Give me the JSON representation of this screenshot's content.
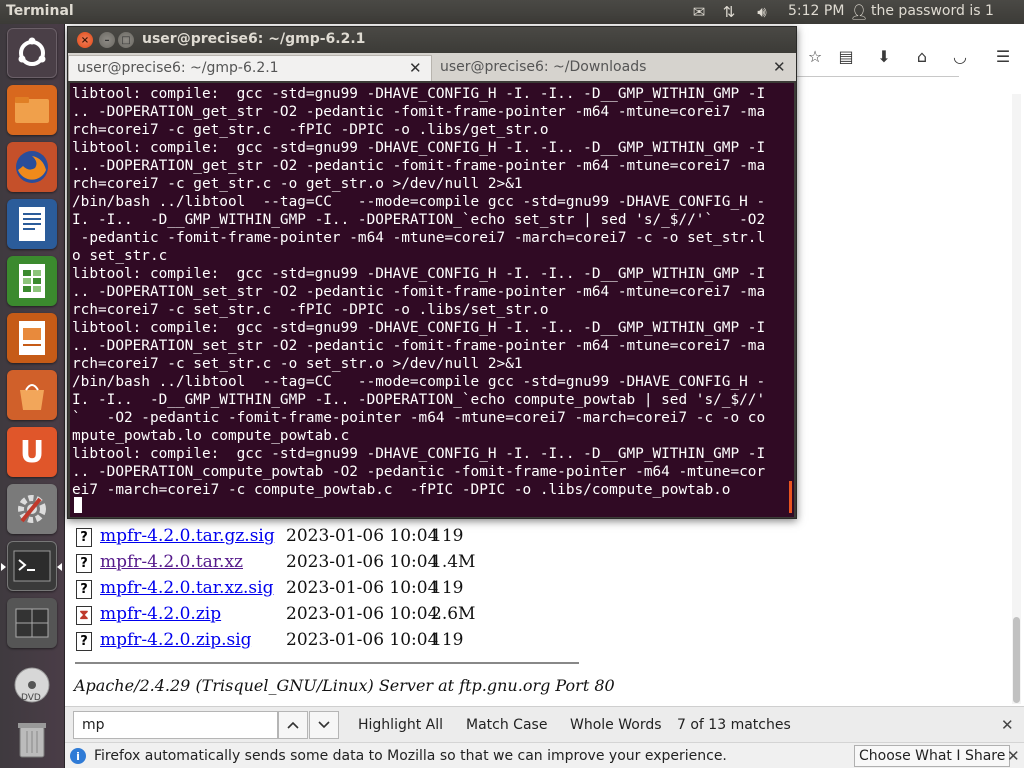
{
  "top_panel": {
    "app_title": "Terminal",
    "clock": "5:12 PM",
    "user_status": "the password is 1",
    "icons": [
      "mail-icon",
      "network-icon",
      "volume-icon",
      "user-icon"
    ]
  },
  "launcher": {
    "items": [
      "dash-icon",
      "files-icon",
      "firefox-icon",
      "writer-icon",
      "calc-icon",
      "impress-icon",
      "software-center-icon",
      "ubuntu-one-icon",
      "system-settings-icon",
      "terminal-icon",
      "workspace-switcher-icon",
      "dvd-icon",
      "trash-icon"
    ]
  },
  "terminal": {
    "window_title": "user@precise6: ~/gmp-6.2.1",
    "tabs": [
      {
        "label": "user@precise6: ~/gmp-6.2.1"
      },
      {
        "label": "user@precise6: ~/Downloads"
      }
    ],
    "lines": [
      "libtool: compile:  gcc -std=gnu99 -DHAVE_CONFIG_H -I. -I.. -D__GMP_WITHIN_GMP -I",
      ".. -DOPERATION_get_str -O2 -pedantic -fomit-frame-pointer -m64 -mtune=corei7 -ma",
      "rch=corei7 -c get_str.c  -fPIC -DPIC -o .libs/get_str.o",
      "libtool: compile:  gcc -std=gnu99 -DHAVE_CONFIG_H -I. -I.. -D__GMP_WITHIN_GMP -I",
      ".. -DOPERATION_get_str -O2 -pedantic -fomit-frame-pointer -m64 -mtune=corei7 -ma",
      "rch=corei7 -c get_str.c -o get_str.o >/dev/null 2>&1",
      "/bin/bash ../libtool  --tag=CC   --mode=compile gcc -std=gnu99 -DHAVE_CONFIG_H -",
      "I. -I..  -D__GMP_WITHIN_GMP -I.. -DOPERATION_`echo set_str | sed 's/_$//'`   -O2",
      " -pedantic -fomit-frame-pointer -m64 -mtune=corei7 -march=corei7 -c -o set_str.l",
      "o set_str.c",
      "libtool: compile:  gcc -std=gnu99 -DHAVE_CONFIG_H -I. -I.. -D__GMP_WITHIN_GMP -I",
      ".. -DOPERATION_set_str -O2 -pedantic -fomit-frame-pointer -m64 -mtune=corei7 -ma",
      "rch=corei7 -c set_str.c  -fPIC -DPIC -o .libs/set_str.o",
      "libtool: compile:  gcc -std=gnu99 -DHAVE_CONFIG_H -I. -I.. -D__GMP_WITHIN_GMP -I",
      ".. -DOPERATION_set_str -O2 -pedantic -fomit-frame-pointer -m64 -mtune=corei7 -ma",
      "rch=corei7 -c set_str.c -o set_str.o >/dev/null 2>&1",
      "/bin/bash ../libtool  --tag=CC   --mode=compile gcc -std=gnu99 -DHAVE_CONFIG_H -",
      "I. -I..  -D__GMP_WITHIN_GMP -I.. -DOPERATION_`echo compute_powtab | sed 's/_$//'",
      "`   -O2 -pedantic -fomit-frame-pointer -m64 -mtune=corei7 -march=corei7 -c -o co",
      "mpute_powtab.lo compute_powtab.c",
      "libtool: compile:  gcc -std=gnu99 -DHAVE_CONFIG_H -I. -I.. -D__GMP_WITHIN_GMP -I",
      ".. -DOPERATION_compute_powtab -O2 -pedantic -fomit-frame-pointer -m64 -mtune=cor",
      "ei7 -march=corei7 -c compute_powtab.c  -fPIC -DPIC -o .libs/compute_powtab.o"
    ]
  },
  "listing": {
    "files": [
      {
        "name": "mpfr-4.2.0.tar.gz.sig",
        "date": "2023-01-06 10:04",
        "size": "119",
        "icon": "unknown-file-icon",
        "visited": false
      },
      {
        "name": "mpfr-4.2.0.tar.xz",
        "date": "2023-01-06 10:04",
        "size": "1.4M",
        "icon": "unknown-file-icon",
        "visited": true
      },
      {
        "name": "mpfr-4.2.0.tar.xz.sig",
        "date": "2023-01-06 10:04",
        "size": "119",
        "icon": "unknown-file-icon",
        "visited": false
      },
      {
        "name": "mpfr-4.2.0.zip",
        "date": "2023-01-06 10:04",
        "size": "2.6M",
        "icon": "archive-file-icon",
        "visited": false
      },
      {
        "name": "mpfr-4.2.0.zip.sig",
        "date": "2023-01-06 10:04",
        "size": "119",
        "icon": "unknown-file-icon",
        "visited": false
      }
    ],
    "server_signature": "Apache/2.4.29 (Trisquel_GNU/Linux) Server at ftp.gnu.org Port 80"
  },
  "findbar": {
    "query": "mp",
    "highlight_all": "Highlight All",
    "match_case": "Match Case",
    "whole_words": "Whole Words",
    "status": "7 of 13 matches"
  },
  "notification": {
    "text": "Firefox automatically sends some data to Mozilla so that we can improve your experience.",
    "button": "Choose What I Share"
  },
  "colors": {
    "terminal_bg": "#300a24",
    "accent": "#e95420",
    "link": "#0000ee",
    "visited_link": "#551a8b"
  }
}
